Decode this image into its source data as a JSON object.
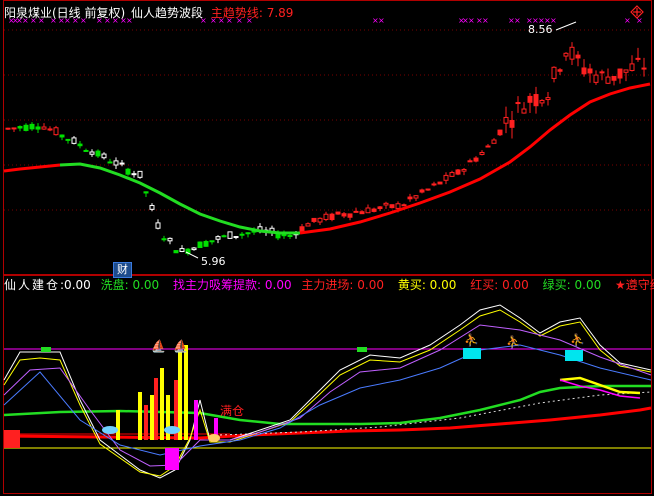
{
  "main_header": {
    "title": "阳泉煤业(日线 前复权)",
    "indicator_name": "仙人趋势波段",
    "trend_label": "主趋势线: 7.89"
  },
  "main_chart": {
    "high_label": "8.56",
    "low_label": "5.96",
    "fin_badge": "财"
  },
  "sub_header": {
    "name": "仙人建仓",
    "name_value": ":0.00",
    "wash_label": "洗盘: 0.00",
    "absorb_label": "找主力吸筹提款: 0.00",
    "main_entry_label": "主力进场: 0.00",
    "yellow_buy_label": "黄买: 0.00",
    "red_buy_label": "红买: 0.00",
    "green_buy_label": "绿买: 0.00",
    "discipline_label": "★遵守纪"
  },
  "sub_chart": {
    "full_position_label": "满仓"
  },
  "colors": {
    "bg": "#000000",
    "frame": "#b00000",
    "up": "#ff2020",
    "down": "#00e000",
    "trend_red": "#ff0000",
    "trend_green": "#22dd22",
    "magenta": "#ff00ff",
    "yellow": "#ffff00",
    "cyan": "#00e5ee",
    "white": "#ffffff"
  },
  "chart_data": {
    "type": "candlestick",
    "y_labels": [
      "8.56",
      "5.96"
    ],
    "trend_value": 7.89
  }
}
